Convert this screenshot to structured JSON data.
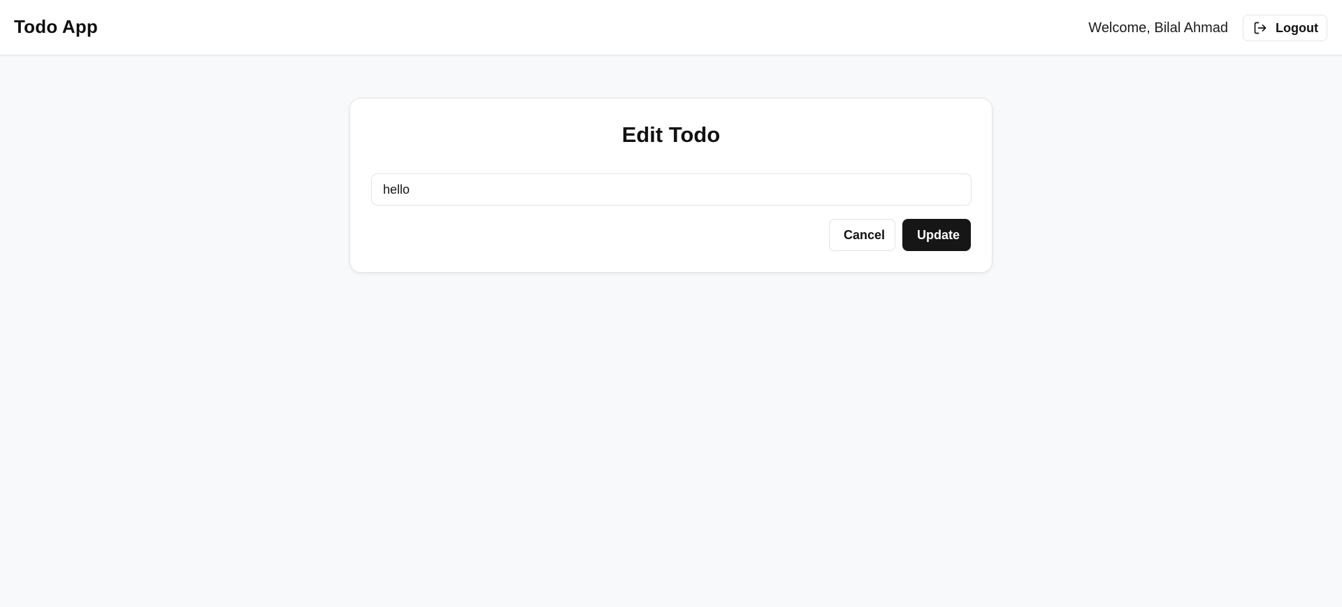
{
  "navbar": {
    "brand": "Todo App",
    "welcome_text": "Welcome, Bilal Ahmad",
    "logout_label": "Logout",
    "logout_icon": "logout-icon"
  },
  "edit_card": {
    "title": "Edit Todo",
    "input_value": "hello",
    "cancel_label": "Cancel",
    "update_label": "Update"
  },
  "colors": {
    "background": "#f8f9fb",
    "surface": "#ffffff",
    "primary_button": "#161616",
    "border": "#e3e5e8"
  }
}
